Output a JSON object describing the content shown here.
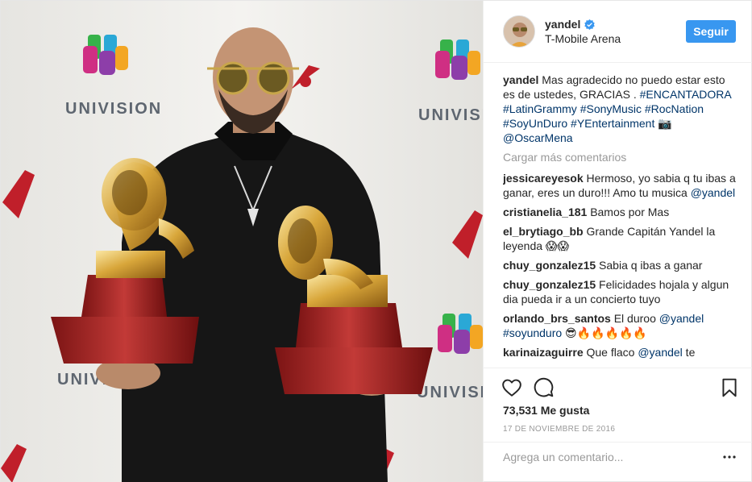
{
  "post": {
    "username": "yandel",
    "location": "T-Mobile Arena",
    "follow_label": "Seguir",
    "caption": {
      "username": "yandel",
      "text": "Mas agradecido no puedo estar esto es de ustedes, GRACIAS . ",
      "hashtags": [
        "#ENCANTADORA",
        "#LatinGrammy",
        "#SonyMusic",
        "#RocNation",
        "#SoyUnDuro",
        "#YEntertainment"
      ],
      "camera_emoji": "📷",
      "mention": "@OscarMena"
    },
    "load_more_label": "Cargar más comentarios",
    "comments": [
      {
        "user": "jessicareyesok",
        "text": "Hermoso, yo sabia q tu ibas a ganar, eres un duro!!! Amo tu musica ",
        "mention": "@yandel"
      },
      {
        "user": "cristianelia_181",
        "text": "Bamos por Mas"
      },
      {
        "user": "el_brytiago_bb",
        "text": "Grande Capitán Yandel la leyenda 😱😱"
      },
      {
        "user": "chuy_gonzalez15",
        "text": "Sabia q ibas a ganar"
      },
      {
        "user": "chuy_gonzalez15",
        "text": "Felicidades hojala y algun dia pueda ir a un concierto tuyo"
      },
      {
        "user": "orlando_brs_santos",
        "text": "El duroo ",
        "mention": "@yandel",
        "hashtag": "#soyunduro",
        "emoji": " 😎🔥🔥🔥🔥🔥"
      },
      {
        "user": "karinaizaguirre",
        "text": "Que flaco ",
        "mention": "@yandel",
        "suffix": " te"
      }
    ],
    "likes": "73,531 Me gusta",
    "date": "17 DE NOVIEMBRE DE 2016",
    "comment_placeholder": "Agrega un comentario...",
    "photo_logo_text": "UNIVISION"
  },
  "icons": {
    "like": "heart-icon",
    "comment": "comment-bubble-icon",
    "save": "bookmark-icon",
    "more": "more-dots-icon",
    "verified": "verified-badge-icon"
  },
  "colors": {
    "accent": "#3897f0",
    "link": "#003569",
    "muted": "#999999"
  }
}
